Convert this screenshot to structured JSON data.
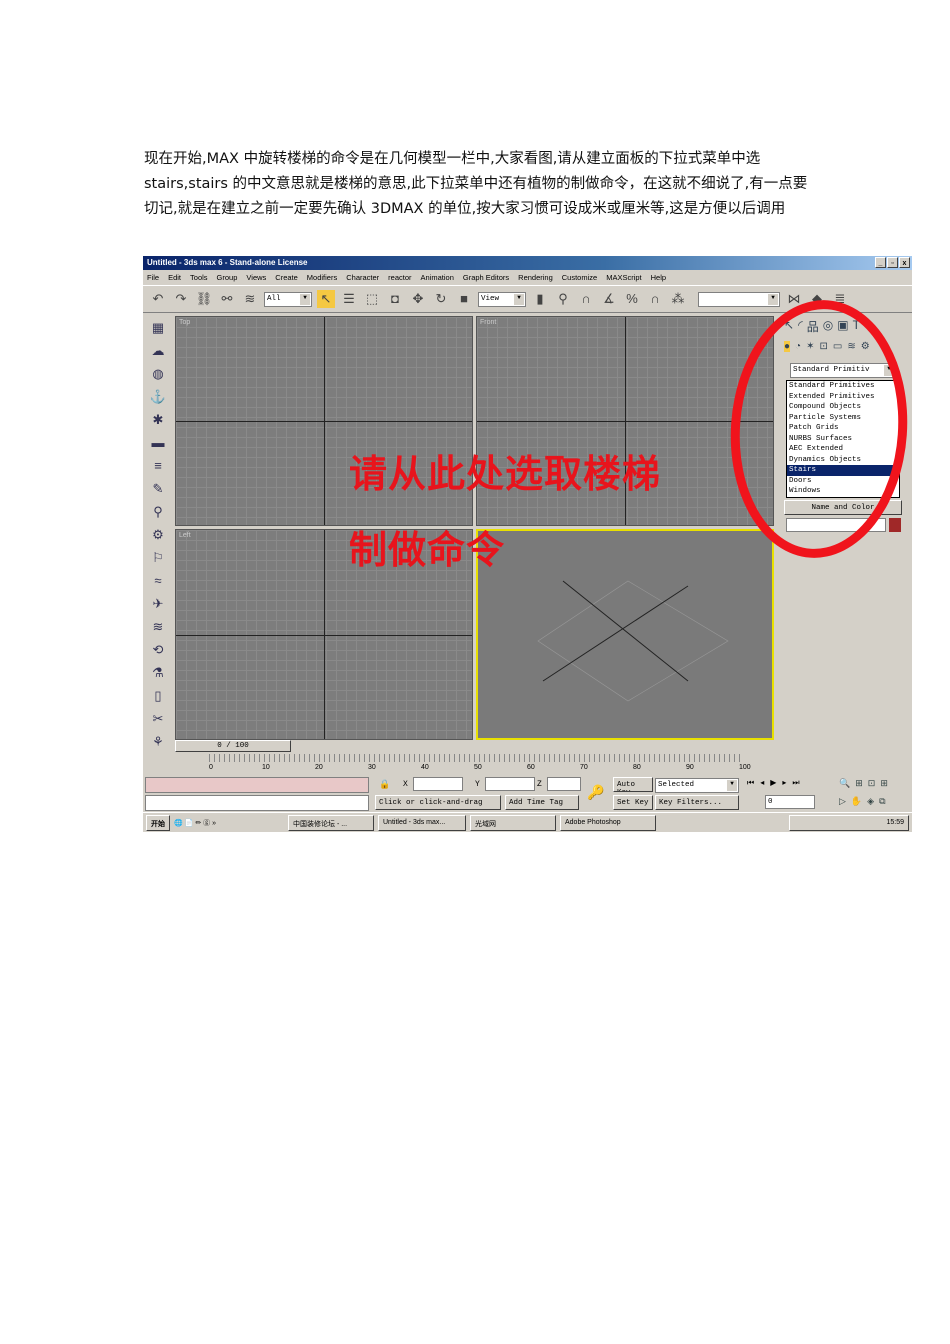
{
  "paragraph": "现在开始,MAX 中旋转楼梯的命令是在几何模型一栏中,大家看图,请从建立面板的下拉式菜单中选 stairs,stairs 的中文意思就是楼梯的意思,此下拉菜单中还有植物的制做命令，在这就不细说了,有一点要切记,就是在建立之前一定要先确认 3DMAX 的单位,按大家习惯可设成米或厘米等,这是方便以后调用",
  "app": {
    "title": "Untitled - 3ds max 6 - Stand-alone License",
    "menu": [
      "File",
      "Edit",
      "Tools",
      "Group",
      "Views",
      "Create",
      "Modifiers",
      "Character",
      "reactor",
      "Animation",
      "Graph Editors",
      "Rendering",
      "Customize",
      "MAXScript",
      "Help"
    ],
    "selection_filter": "All",
    "ref_coord": "View",
    "viewports": [
      "Top",
      "Front",
      "Left"
    ],
    "annotation": [
      "请从此处选取楼梯",
      "制做命令"
    ],
    "category_selected": "Standard Primitiv",
    "category_options": [
      "Standard Primitives",
      "Extended Primitives",
      "Compound Objects",
      "Particle Systems",
      "Patch Grids",
      "NURBS Surfaces",
      "AEC Extended",
      "Dynamics Objects",
      "Stairs",
      "Doors",
      "Windows"
    ],
    "rollout": "Name and Color",
    "time_slider": "0 / 100",
    "ticks": [
      "0",
      "10",
      "20",
      "30",
      "40",
      "50",
      "60",
      "70",
      "80",
      "90",
      "100"
    ],
    "coords": {
      "x": "X",
      "y": "Y",
      "z": "Z"
    },
    "prompt": "Click or click-and-drag",
    "add_time_tag": "Add Time Tag",
    "auto_key": "Auto Key",
    "set_key": "Set Key",
    "key_mode": "Selected",
    "key_filters": "Key Filters...",
    "frame": "0",
    "taskbar": {
      "start": "开始",
      "items": [
        "中国装修论坛 - ...",
        "Untitled - 3ds max...",
        "光域网",
        "Adobe Photoshop"
      ],
      "clock": "15:59"
    }
  }
}
